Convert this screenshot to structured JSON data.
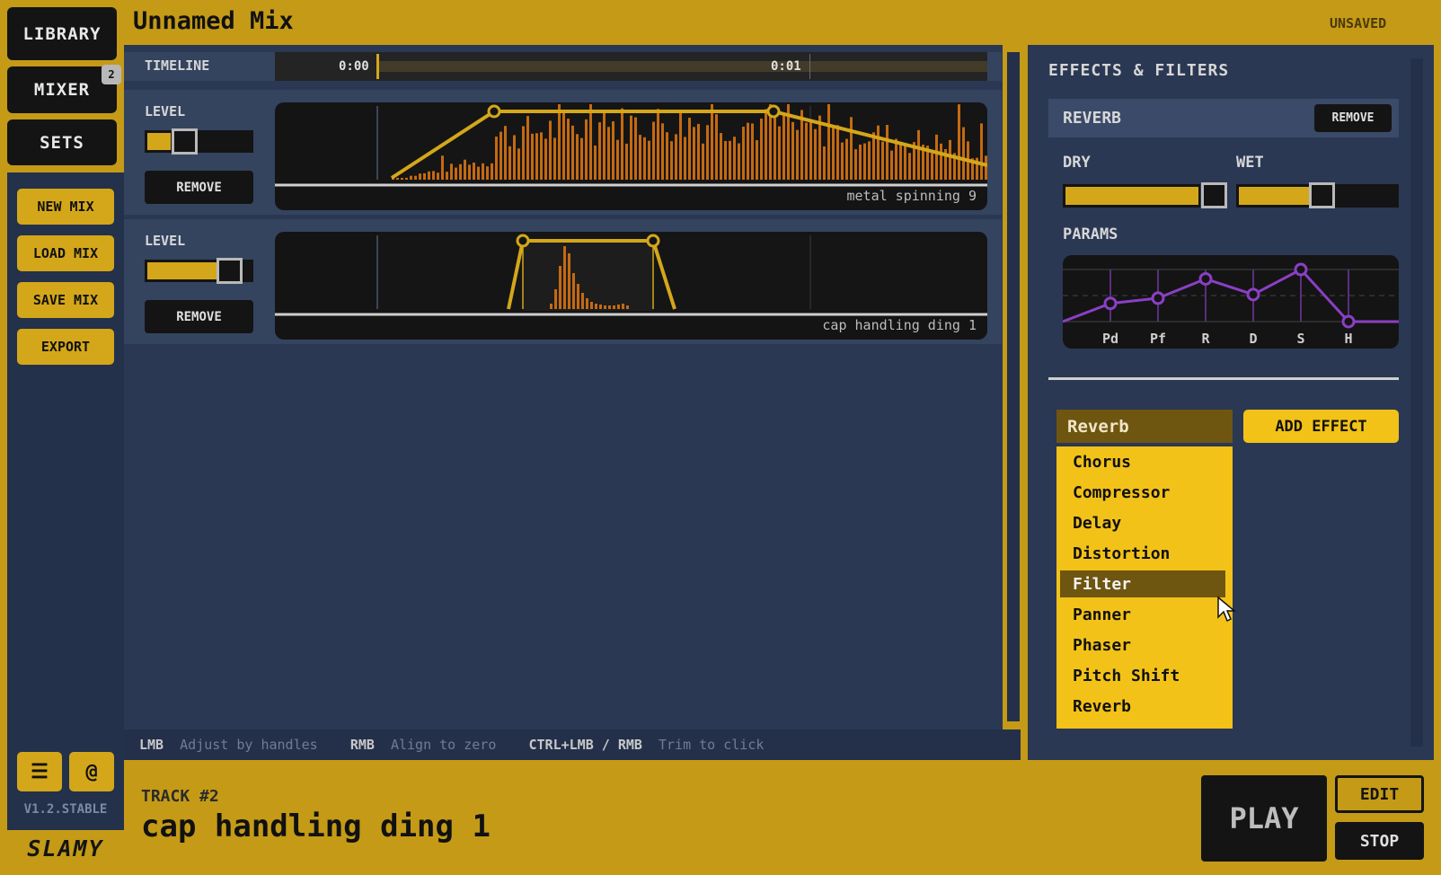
{
  "app": {
    "title": "Unnamed Mix",
    "status": "UNSAVED",
    "version": "V1.2.STABLE",
    "logo": "SLAMY"
  },
  "nav": {
    "library": "LIBRARY",
    "mixer": "MIXER",
    "mixer_badge": "2",
    "sets": "SETS"
  },
  "actions": {
    "new_mix": "NEW MIX",
    "load_mix": "LOAD MIX",
    "save_mix": "SAVE MIX",
    "export": "EXPORT",
    "menu_icon": "hamburger-icon",
    "at_icon": "at-icon"
  },
  "timeline": {
    "label": "TIMELINE",
    "start": "0:00",
    "mark": "0:01"
  },
  "tracks": [
    {
      "level_label": "LEVEL",
      "level": 0.22,
      "remove": "REMOVE",
      "name": "metal spinning 9"
    },
    {
      "level_label": "LEVEL",
      "level": 0.75,
      "remove": "REMOVE",
      "name": "cap handling ding 1"
    }
  ],
  "hints": {
    "k1": "LMB",
    "t1": "Adjust by handles",
    "k2": "RMB",
    "t2": "Align to zero",
    "k3": "CTRL+LMB / RMB",
    "t3": "Trim to click"
  },
  "effects": {
    "title": "EFFECTS & FILTERS",
    "current": "REVERB",
    "remove": "REMOVE",
    "dry_label": "DRY",
    "dry_value": 0.85,
    "wet_label": "WET",
    "wet_value": 0.5,
    "params_label": "PARAMS",
    "params": [
      {
        "name": "Pd",
        "value": 0.35
      },
      {
        "name": "Pf",
        "value": 0.45
      },
      {
        "name": "R",
        "value": 0.82
      },
      {
        "name": "D",
        "value": 0.52
      },
      {
        "name": "S",
        "value": 1.0
      },
      {
        "name": "H",
        "value": 0.0
      }
    ],
    "select_value": "Reverb",
    "options": [
      "Chorus",
      "Compressor",
      "Delay",
      "Distortion",
      "Filter",
      "Panner",
      "Phaser",
      "Pitch Shift",
      "Reverb"
    ],
    "hovered_option": "Filter",
    "add_button": "ADD EFFECT"
  },
  "footer": {
    "track_label": "TRACK #2",
    "track_name": "cap handling ding 1",
    "play": "PLAY",
    "edit": "EDIT",
    "stop": "STOP"
  },
  "colors": {
    "accent": "#c49a17",
    "bar": "#c46a12",
    "envelope": "#d4a71a",
    "param_line": "#8a3fc4"
  }
}
